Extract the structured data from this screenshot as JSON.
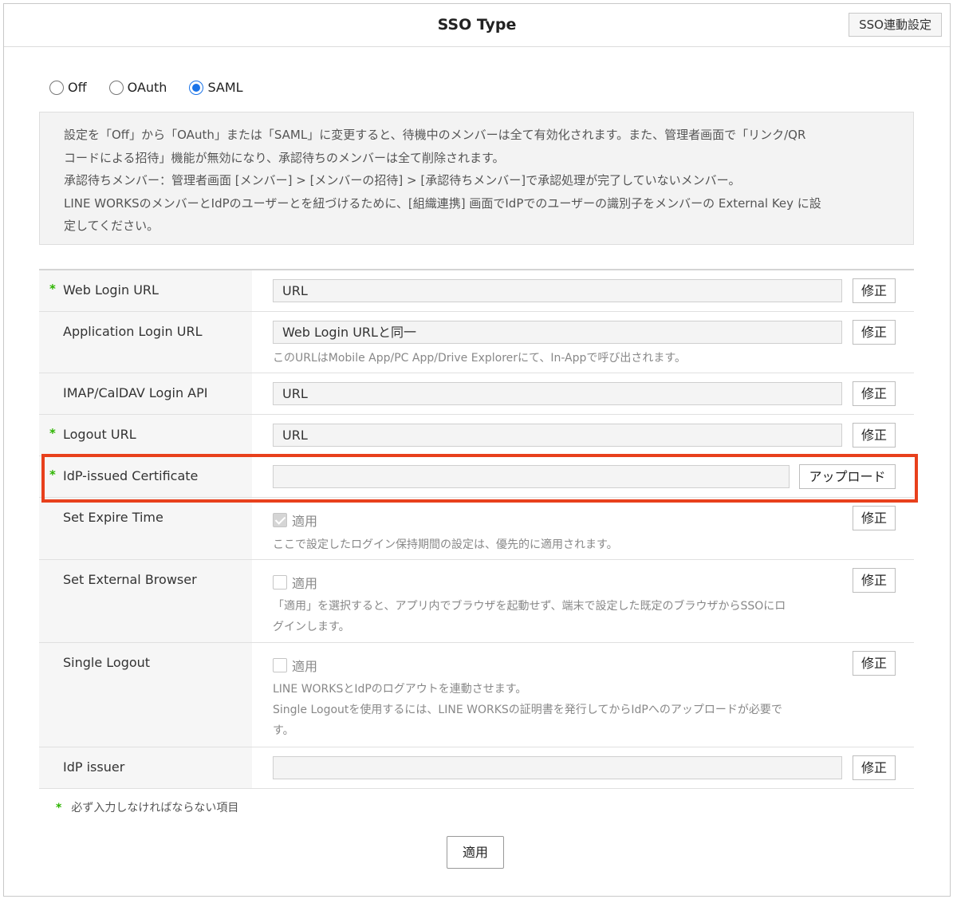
{
  "header": {
    "title": "SSO Type",
    "sso_link_button": "SSO連動設定"
  },
  "sso_type": {
    "options": [
      "Off",
      "OAuth",
      "SAML"
    ],
    "selected": "SAML"
  },
  "notice": {
    "lines": [
      "設定を「Off」から「OAuth」または「SAML」に変更すると、待機中のメンバーは全て有効化されます。また、管理者画面で「リンク/QR",
      "コードによる招待」機能が無効になり、承認待ちのメンバーは全て削除されます。",
      "承認待ちメンバー：管理者画面 [メンバー] > [メンバーの招待] > [承認待ちメンバー]で承認処理が完了していないメンバー。",
      "LINE WORKSのメンバーとIdPのユーザーとを紐づけるために、[組織連携] 画面でIdPでのユーザーの識別子をメンバーの External Key に設",
      "定してください。"
    ]
  },
  "form": {
    "required_mark": "*",
    "edit_label": "修正",
    "upload_label": "アップロード",
    "apply_label": "適用",
    "rows": [
      {
        "label": "Web Login URL",
        "required": true,
        "value": "URL"
      },
      {
        "label": "Application Login URL",
        "required": false,
        "value": "Web Login URLと同一",
        "hint": "このURLはMobile App/PC App/Drive Explorerにて、In-Appで呼び出されます。"
      },
      {
        "label": "IMAP/CalDAV Login API",
        "required": false,
        "value": "URL"
      },
      {
        "label": "Logout URL",
        "required": true,
        "value": "URL"
      },
      {
        "label": "IdP-issued Certificate",
        "required": true,
        "value": ""
      },
      {
        "label": "Set Expire Time",
        "required": false,
        "checked": true,
        "hint": "ここで設定したログイン保持期間の設定は、優先的に適用されます。"
      },
      {
        "label": "Set External Browser",
        "required": false,
        "checked": false,
        "hint_lines": [
          "「適用」を選択すると、アプリ内でブラウザを起動せず、端末で設定した既定のブラウザからSSOにロ",
          "グインします。"
        ]
      },
      {
        "label": "Single Logout",
        "required": false,
        "checked": false,
        "hint_lines": [
          "LINE WORKSとIdPのログアウトを連動させます。",
          "Single Logoutを使用するには、LINE WORKSの証明書を発行してからIdPへのアップロードが必要で",
          "す。"
        ]
      },
      {
        "label": "IdP issuer",
        "required": false,
        "value": ""
      }
    ]
  },
  "footer": {
    "required_note": "必ず入力しなければならない項目",
    "apply_button": "適用"
  },
  "colors": {
    "accent": "#1a73e8",
    "required_star": "#2db400",
    "highlight": "#e8401c"
  }
}
